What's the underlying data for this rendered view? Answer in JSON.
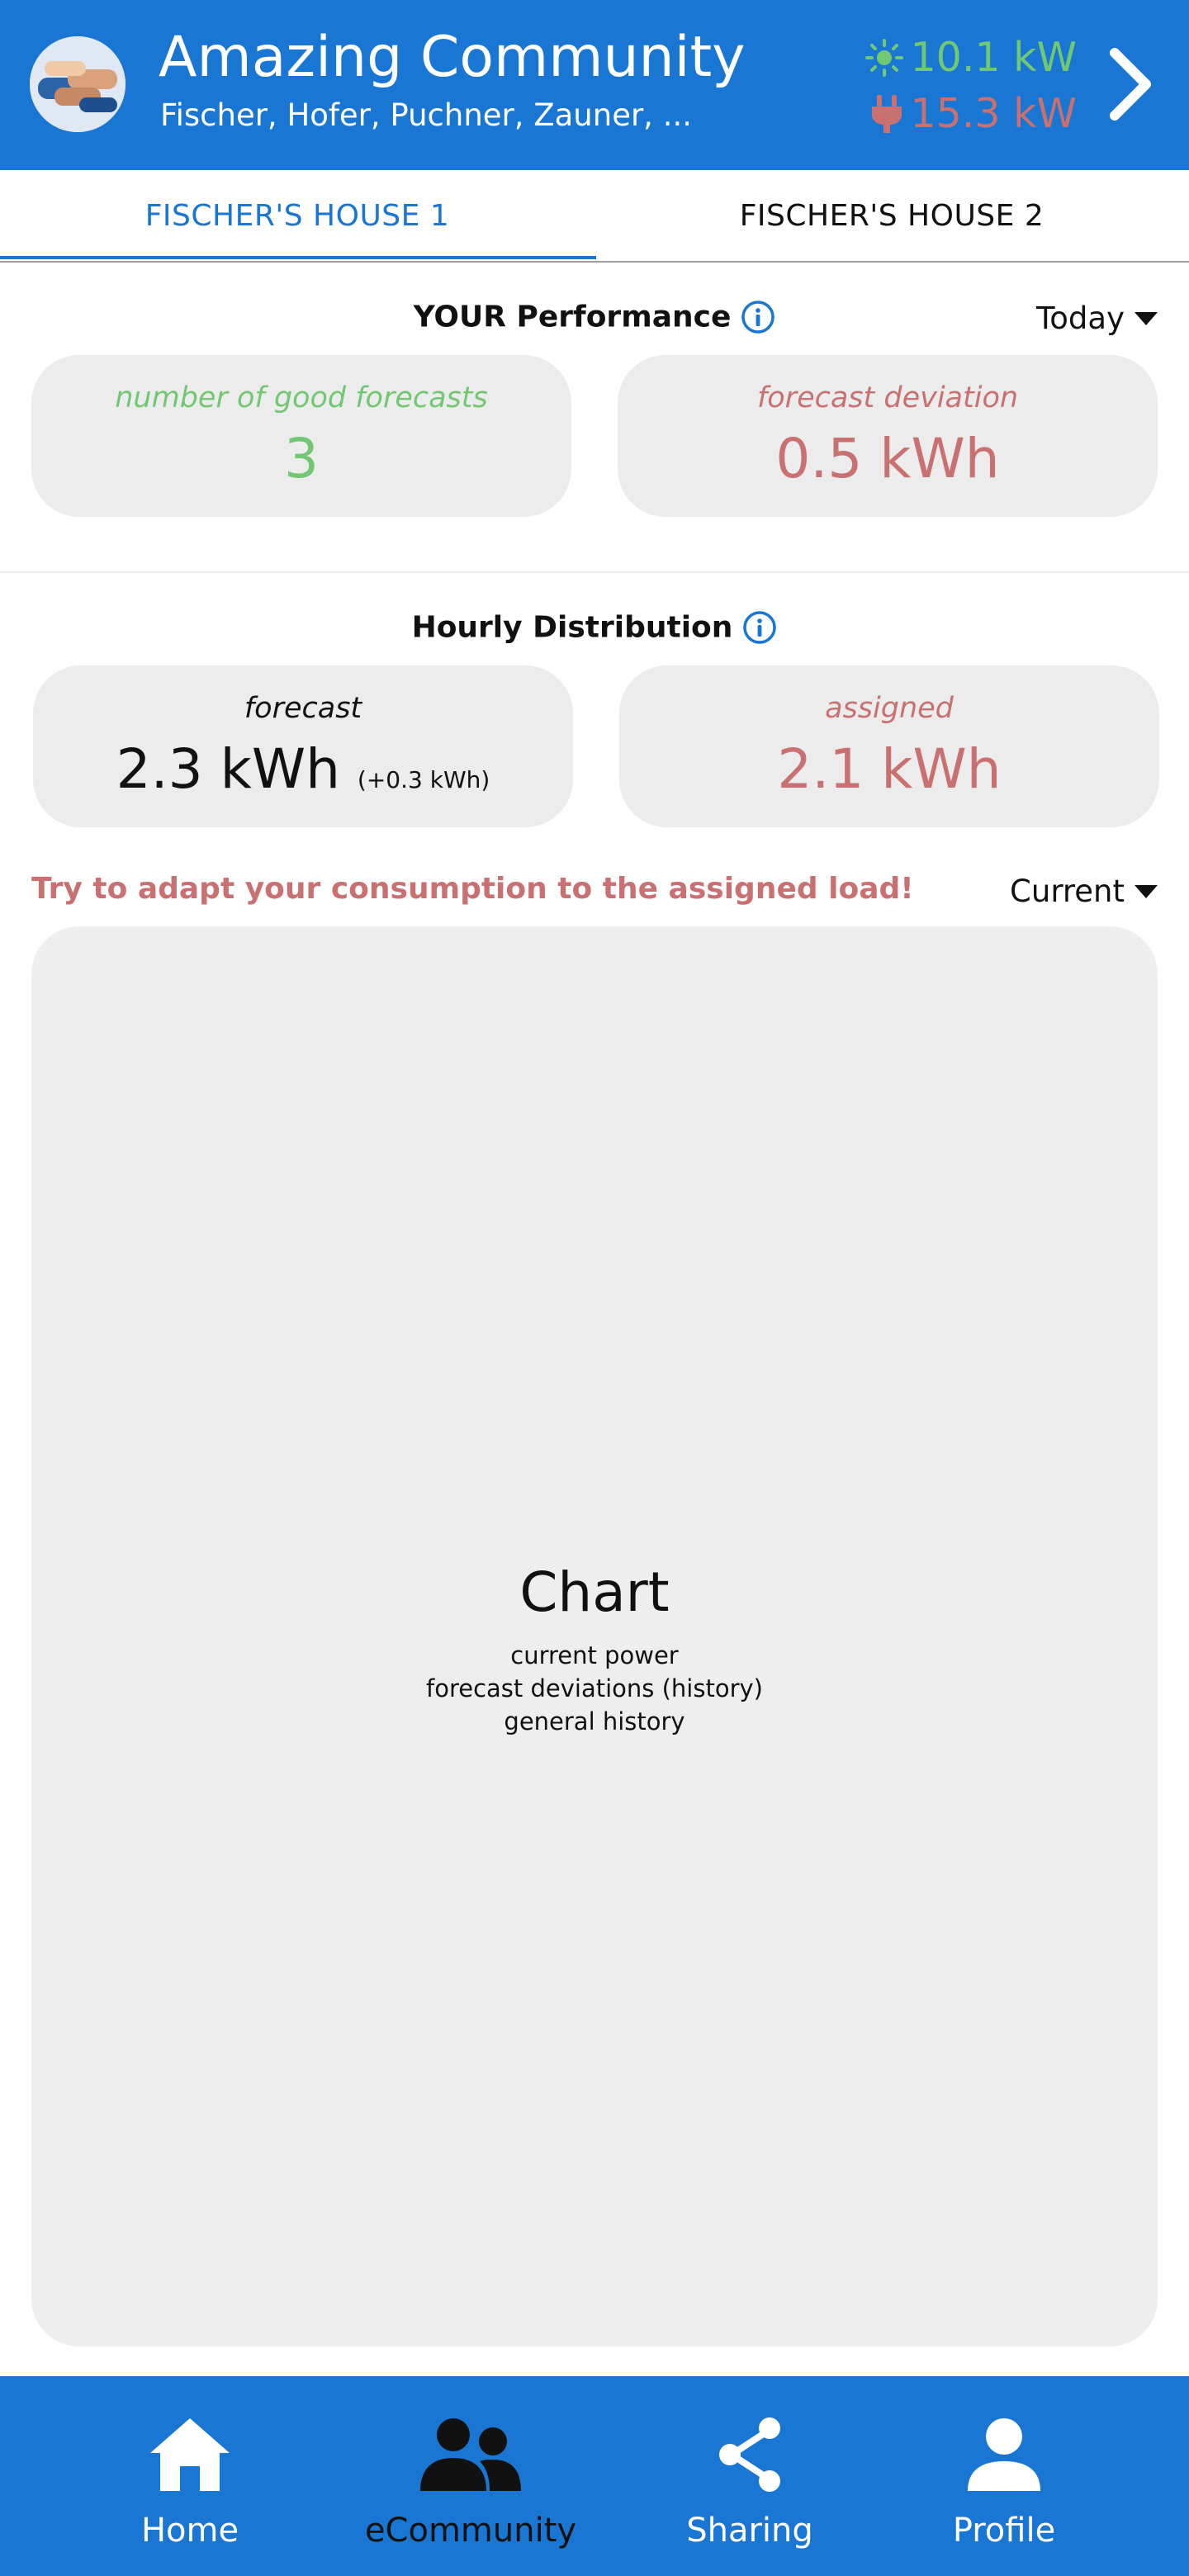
{
  "header": {
    "title": "Amazing Community",
    "subtitle": "Fischer, Hofer, Puchner, Zauner, ...",
    "solar_power": "10.1 kW",
    "grid_power": "15.3 kW"
  },
  "tabs": [
    {
      "label": "FISCHER'S HOUSE 1",
      "active": true
    },
    {
      "label": "FISCHER'S HOUSE 2",
      "active": false
    }
  ],
  "performance": {
    "title": "YOUR Performance",
    "period": "Today",
    "cards": [
      {
        "label": "number of good forecasts",
        "value": "3"
      },
      {
        "label": "forecast deviation",
        "value": "0.5 kWh"
      }
    ]
  },
  "hourly": {
    "title": "Hourly Distribution",
    "forecast_label": "forecast",
    "forecast_value": "2.3 kWh",
    "forecast_delta": "(+0.3 kWh)",
    "assigned_label": "assigned",
    "assigned_value": "2.1 kWh"
  },
  "hint": "Try to adapt your consumption to the assigned load!",
  "chart_selector": "Current",
  "chart_placeholder": {
    "title": "Chart",
    "lines": [
      "current power",
      "forecast deviations (history)",
      "general history"
    ]
  },
  "nav": [
    {
      "label": "Home",
      "icon": "home-icon"
    },
    {
      "label": "eCommunity",
      "icon": "community-icon",
      "active": true
    },
    {
      "label": "Sharing",
      "icon": "share-icon"
    },
    {
      "label": "Profile",
      "icon": "profile-icon"
    }
  ],
  "colors": {
    "primary": "#1976d2",
    "positive": "#72c872",
    "negative": "#c97070",
    "card_bg": "#ececec"
  }
}
